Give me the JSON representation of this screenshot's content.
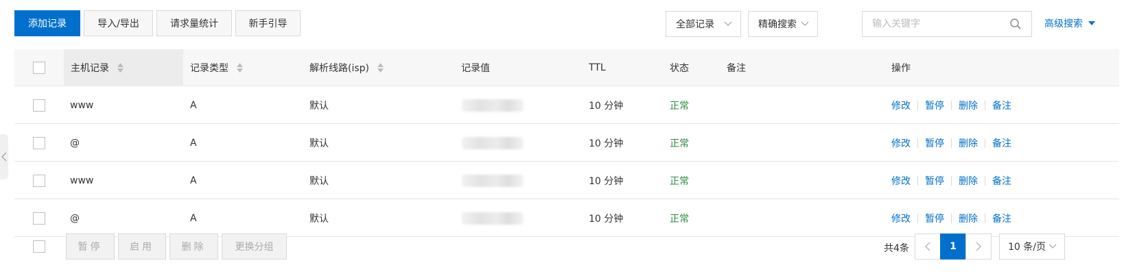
{
  "toolbar": {
    "add_record": "添加记录",
    "import_export": "导入/导出",
    "request_stats": "请求量统计",
    "guide": "新手引导",
    "record_filter": "全部记录",
    "search_mode": "精确搜索",
    "search_placeholder": "输入关键字",
    "advanced_search": "高级搜索"
  },
  "table": {
    "columns": [
      "主机记录",
      "记录类型",
      "解析线路(isp)",
      "记录值",
      "TTL",
      "状态",
      "备注",
      "操作"
    ],
    "rows": [
      {
        "host": "www",
        "type": "A",
        "line": "默认",
        "value": "",
        "ttl": "10 分钟",
        "status": "正常",
        "remark": ""
      },
      {
        "host": "@",
        "type": "A",
        "line": "默认",
        "value": "",
        "ttl": "10 分钟",
        "status": "正常",
        "remark": ""
      },
      {
        "host": "www",
        "type": "A",
        "line": "默认",
        "value": "",
        "ttl": "10 分钟",
        "status": "正常",
        "remark": ""
      },
      {
        "host": "@",
        "type": "A",
        "line": "默认",
        "value": "",
        "ttl": "10 分钟",
        "status": "正常",
        "remark": ""
      }
    ],
    "actions": [
      "修改",
      "暂停",
      "删除",
      "备注"
    ]
  },
  "footer": {
    "pause": "暂停",
    "enable": "启用",
    "delete": "删除",
    "change_group": "更换分组",
    "total": "共4条",
    "current_page": "1",
    "page_size": "10 条/页"
  },
  "colors": {
    "primary": "#0070cc",
    "status_ok": "#2d8c3b"
  }
}
